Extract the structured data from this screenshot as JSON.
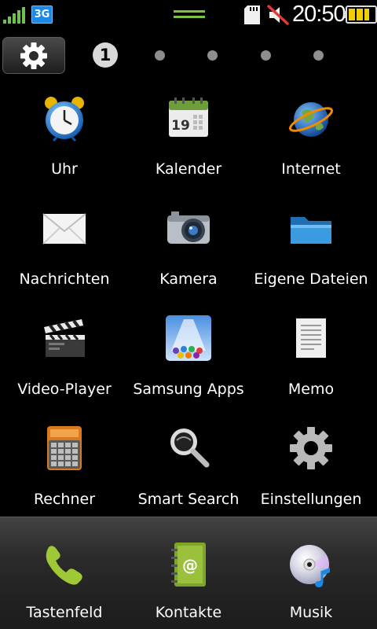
{
  "status_bar": {
    "network_type": "3G",
    "time": "20:50",
    "icons": [
      "signal-strength-icon",
      "network-3g-icon",
      "notification-handle-icon",
      "sd-card-icon",
      "silent-mode-icon",
      "battery-icon"
    ]
  },
  "page_indicator": {
    "current_page": "1",
    "total_pages": 5,
    "settings_icon": "gear-icon"
  },
  "apps": [
    {
      "label": "Uhr",
      "icon": "alarm-clock-icon"
    },
    {
      "label": "Kalender",
      "icon": "calendar-icon"
    },
    {
      "label": "Internet",
      "icon": "globe-icon"
    },
    {
      "label": "Nachrichten",
      "icon": "envelope-icon"
    },
    {
      "label": "Kamera",
      "icon": "camera-icon"
    },
    {
      "label": "Eigene Dateien",
      "icon": "folder-icon"
    },
    {
      "label": "Video-Player",
      "icon": "clapperboard-icon"
    },
    {
      "label": "Samsung Apps",
      "icon": "samsung-apps-icon"
    },
    {
      "label": "Memo",
      "icon": "memo-icon"
    },
    {
      "label": "Rechner",
      "icon": "calculator-icon"
    },
    {
      "label": "Smart Search",
      "icon": "magnifier-icon"
    },
    {
      "label": "Einstellungen",
      "icon": "settings-gear-icon"
    }
  ],
  "calendar_day": "19",
  "dock": [
    {
      "label": "Tastenfeld",
      "icon": "phone-icon"
    },
    {
      "label": "Kontakte",
      "icon": "contacts-book-icon"
    },
    {
      "label": "Musik",
      "icon": "music-cd-icon"
    }
  ],
  "colors": {
    "background": "#000000",
    "dock": "#2b2b2b",
    "network_badge": "#1e88e5",
    "battery": "#f2d000",
    "signal": "#6cc24a"
  }
}
